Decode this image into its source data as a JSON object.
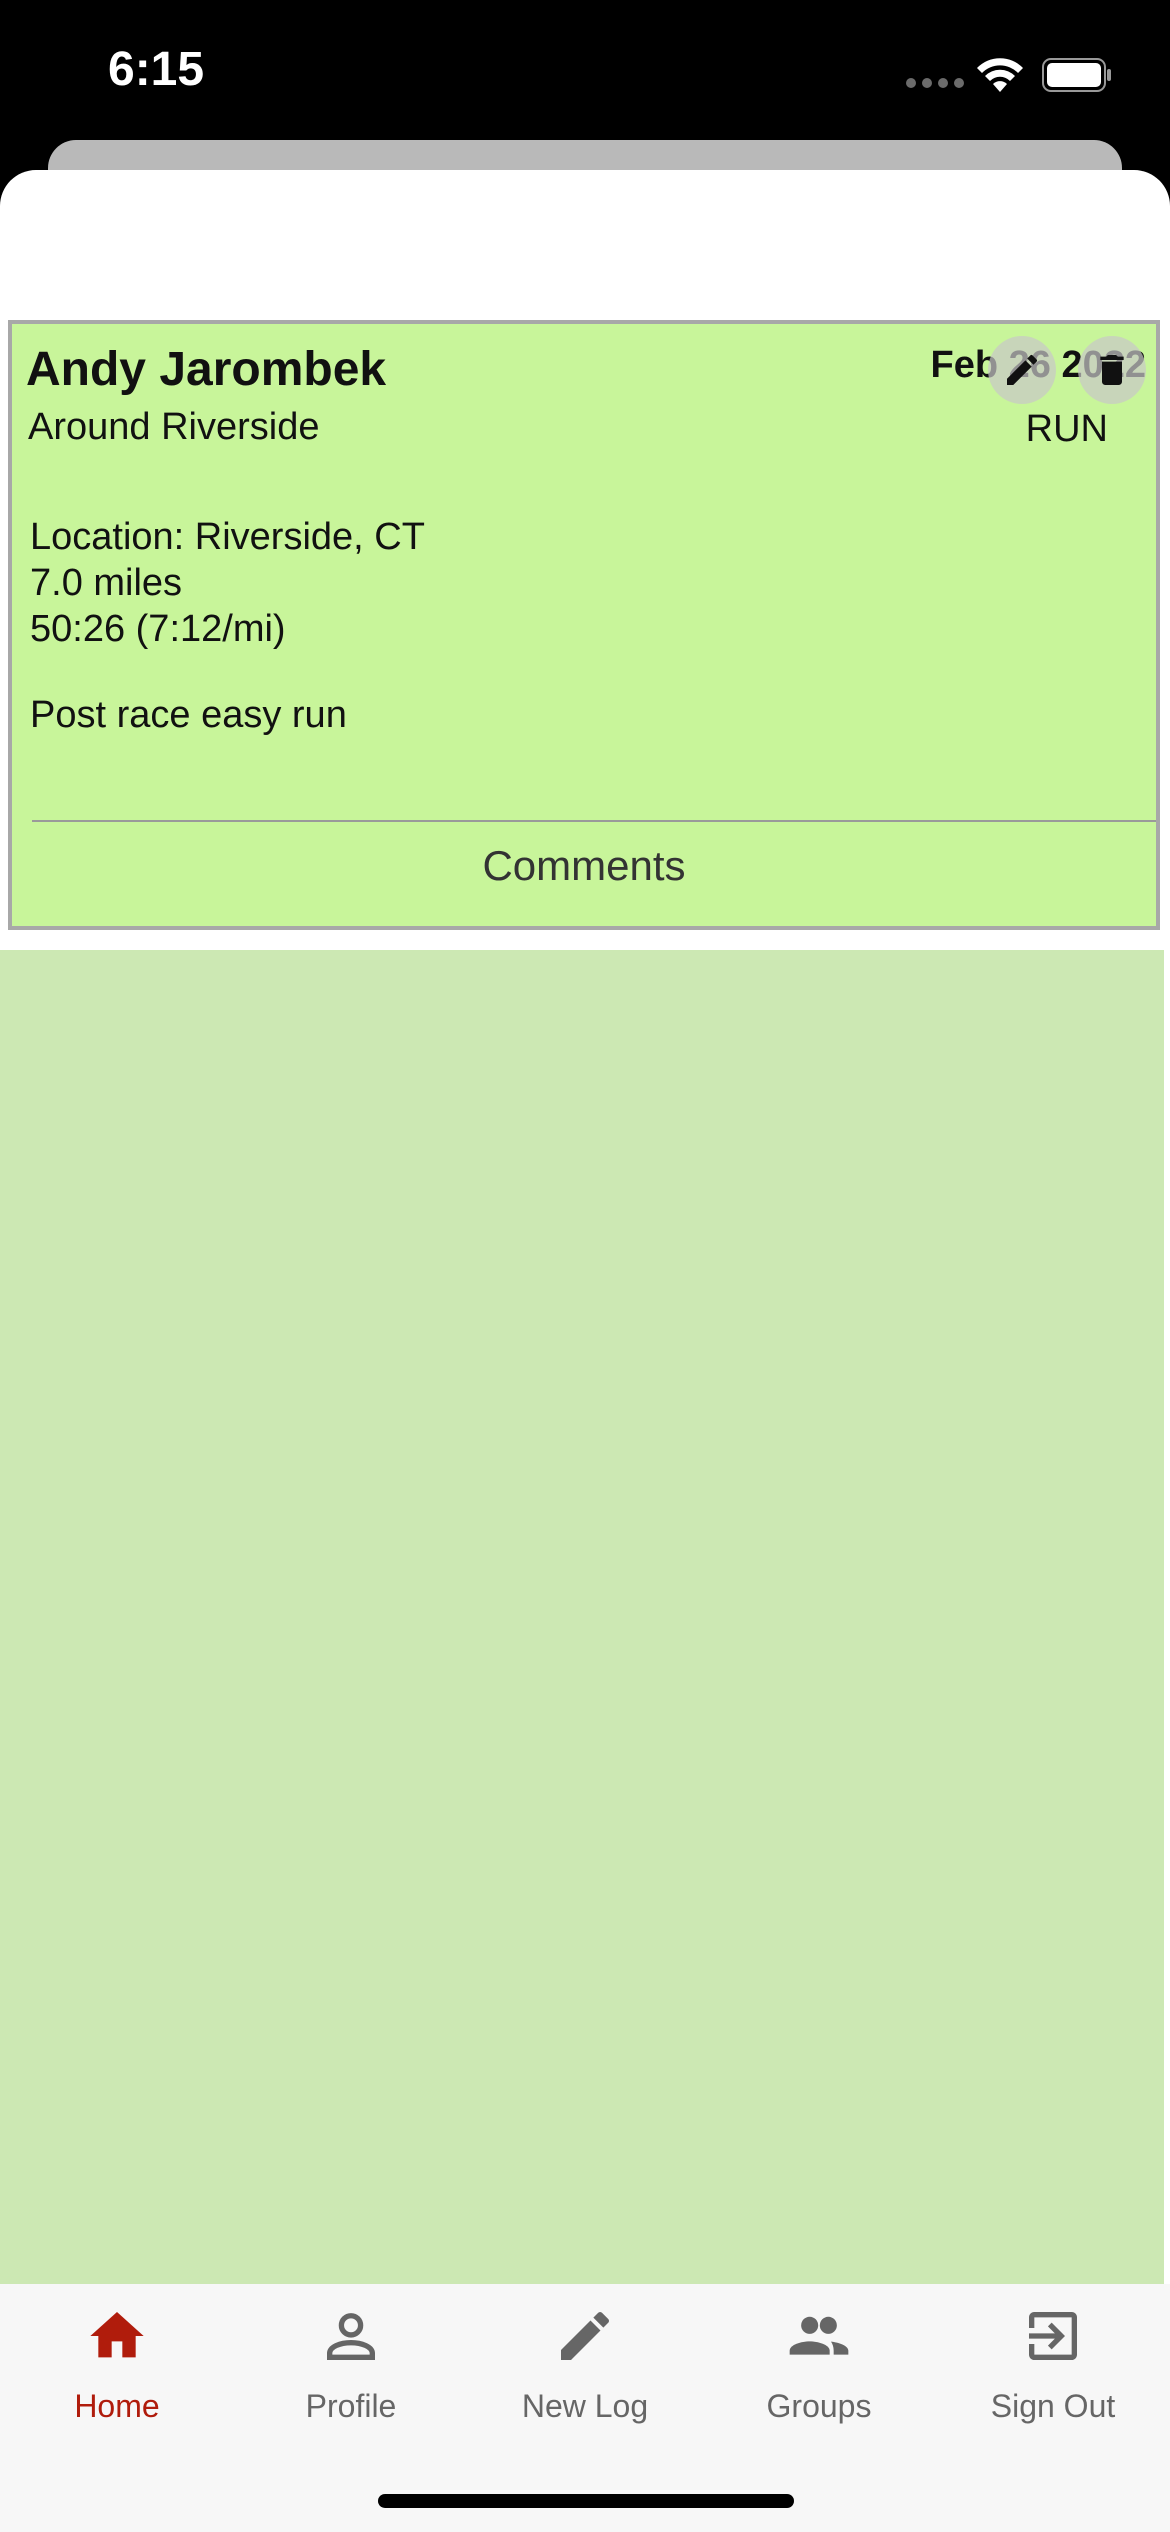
{
  "status_bar": {
    "time": "6:15"
  },
  "post": {
    "author": "Andy Jarombek",
    "route": "Around Riverside",
    "date": "Feb 26 2022",
    "type": "RUN",
    "location": "Location: Riverside, CT",
    "distance": "7.0 miles",
    "time_pace": "50:26 (7:12/mi)",
    "notes": "Post race easy run",
    "comments_label": "Comments"
  },
  "tabs": [
    {
      "label": "Home",
      "icon": "home-icon",
      "active": true
    },
    {
      "label": "Profile",
      "icon": "profile-icon",
      "active": false
    },
    {
      "label": "New Log",
      "icon": "pencil-icon",
      "active": false
    },
    {
      "label": "Groups",
      "icon": "groups-icon",
      "active": false
    },
    {
      "label": "Sign Out",
      "icon": "sign-out-icon",
      "active": false
    }
  ],
  "colors": {
    "card_bg": "#c8f59a",
    "feed_bg": "#cce8b3",
    "active_tab": "#b01c0c",
    "inactive_tab": "#666666"
  }
}
